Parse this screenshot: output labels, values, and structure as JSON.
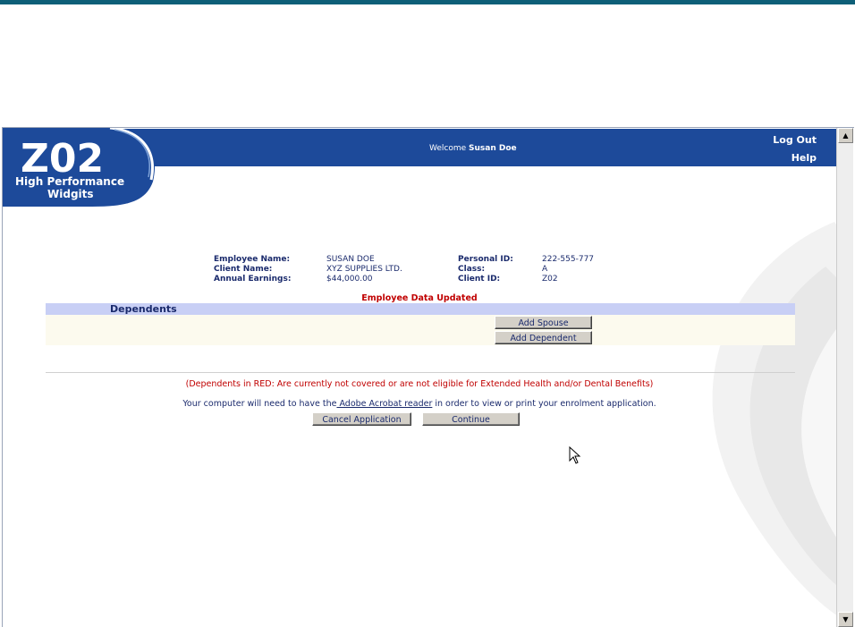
{
  "header": {
    "logo_code": "Z02",
    "logo_line1": "High Performance",
    "logo_line2": "Widgits",
    "welcome_prefix": "Welcome",
    "welcome_user": "Susan Doe",
    "logout_label": "Log Out",
    "help_label": "Help"
  },
  "employee": {
    "name_label": "Employee Name:",
    "name_value": "SUSAN DOE",
    "client_label": "Client Name:",
    "client_value": "XYZ SUPPLIES LTD.",
    "earnings_label": "Annual Earnings:",
    "earnings_value": "$44,000.00",
    "pid_label": "Personal ID:",
    "pid_value": "222-555-777",
    "class_label": "Class:",
    "class_value": "A",
    "clientid_label": "Client ID:",
    "clientid_value": "Z02"
  },
  "status_message": "Employee Data Updated",
  "dependents": {
    "title": "Dependents",
    "add_spouse_label": "Add Spouse",
    "add_dependent_label": "Add Dependent"
  },
  "notes": {
    "red_note": "(Dependents in RED: Are currently not covered or are not eligible for Extended Health and/or Dental Benefits)",
    "acrobat_prefix": "Your computer will need to have the",
    "acrobat_link": " Adobe Acrobat reader",
    "acrobat_suffix": " in order to view or print your enrolment application."
  },
  "actions": {
    "cancel_label": "Cancel Application",
    "continue_label": "Continue"
  },
  "colors": {
    "header_blue": "#1d4a9a",
    "section_lavender": "#c8cff5",
    "alert_red": "#c00000",
    "top_line": "#0e5f78"
  }
}
